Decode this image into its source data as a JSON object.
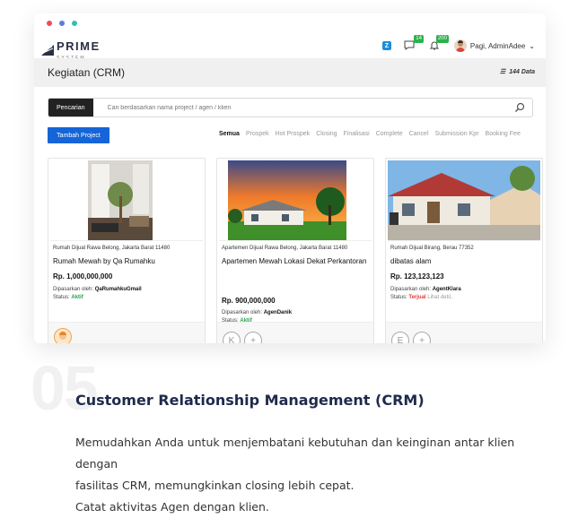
{
  "window": {
    "traffic_lights": [
      "#ee4b5a",
      "#5b7be0",
      "#2ec4a6"
    ]
  },
  "header": {
    "logo_text": "PRIME",
    "logo_subtext": "SYSTEM",
    "z_badge": "Z",
    "messages_count": "14",
    "notifications_count": "200",
    "greeting": "Pagi, AdminAdee"
  },
  "page": {
    "title": "Kegiatan (CRM)",
    "data_count": "144 Data"
  },
  "search": {
    "button_label": "Pencarian",
    "placeholder": "Cari berdasarkan nama project / agen / klien"
  },
  "actions": {
    "add_project": "Tambah Project"
  },
  "tabs": [
    {
      "label": "Semua",
      "active": true
    },
    {
      "label": "Prospek",
      "active": false
    },
    {
      "label": "Hot Prospek",
      "active": false
    },
    {
      "label": "Closing",
      "active": false
    },
    {
      "label": "Finalisasi",
      "active": false
    },
    {
      "label": "Complete",
      "active": false
    },
    {
      "label": "Cancel",
      "active": false
    },
    {
      "label": "Submission Kpr",
      "active": false
    },
    {
      "label": "Booking Fee",
      "active": false
    }
  ],
  "cards": [
    {
      "location": "Rumah Dijual Rawa Belong, Jakarta Barat 11480",
      "title": "Rumah Mewah by Qa Rumahku",
      "price": "Rp. 1,000,000,000",
      "marketed_by_label": "Dipasarkan oleh:",
      "marketed_by": "QaRumahkuGmail",
      "status_label": "Status:",
      "status": "Aktif",
      "detail": ""
    },
    {
      "location": "Apartemen Dijual Rawa Belong, Jakarta Barat 11480",
      "title": "Apartemen Mewah Lokasi Dekat Perkantoran",
      "price": "Rp. 900,000,000",
      "marketed_by_label": "Dipasarkan oleh:",
      "marketed_by": "AgenDanik",
      "status_label": "Status:",
      "status": "Aktif",
      "detail": "",
      "initial": "K"
    },
    {
      "location": "Rumah Dijual Birang, Berau 77352",
      "title": "dibatas alam",
      "price": "Rp. 123,123,123",
      "marketed_by_label": "Dipasarkan oleh:",
      "marketed_by": "AgentKlara",
      "status_label": "Status:",
      "status": "Terjual",
      "detail": "Lihat detil..",
      "initial": "E"
    }
  ],
  "feature": {
    "number": "05",
    "title": "Customer Relationship Management (CRM)",
    "desc_line1": "Memudahkan Anda untuk menjembatani kebutuhan dan keinginan antar klien dengan",
    "desc_line2": "fasilitas CRM, memungkinkan closing lebih cepat.",
    "desc_line3": "Catat aktivitas Agen dengan klien."
  }
}
